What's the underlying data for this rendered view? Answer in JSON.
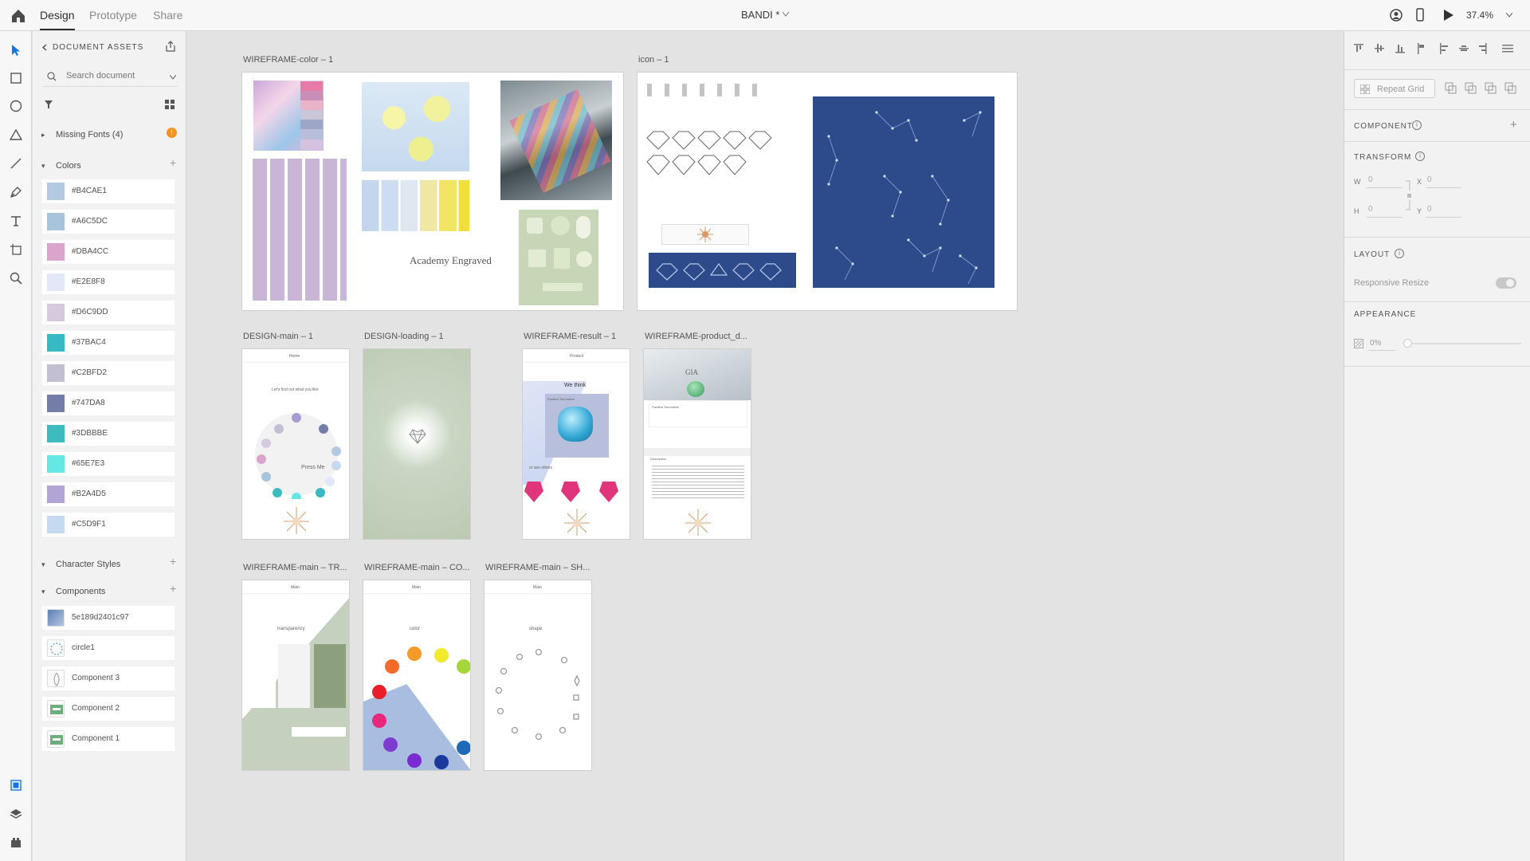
{
  "topbar": {
    "tabs": [
      "Design",
      "Prototype",
      "Share"
    ],
    "document_title": "BANDI *",
    "zoom": "37.4%"
  },
  "assets": {
    "header": "DOCUMENT ASSETS",
    "search_placeholder": "Search document",
    "missing_fonts": "Missing Fonts (4)",
    "colors_label": "Colors",
    "colors": [
      {
        "label": "#B4CAE1",
        "hex": "#B4CAE1"
      },
      {
        "label": "#A6C5DC",
        "hex": "#A6C5DC"
      },
      {
        "label": "#DBA4CC",
        "hex": "#DBA4CC"
      },
      {
        "label": "#E2E8F8",
        "hex": "#E2E8F8"
      },
      {
        "label": "#D6C9DD",
        "hex": "#D6C9DD"
      },
      {
        "label": "#37BAC4",
        "hex": "#37BAC4"
      },
      {
        "label": "#C2BFD2",
        "hex": "#C2BFD2"
      },
      {
        "label": "#747DA8",
        "hex": "#747DA8"
      },
      {
        "label": "#3DBBBE",
        "hex": "#3DBBBE"
      },
      {
        "label": "#65E7E3",
        "hex": "#65E7E3"
      },
      {
        "label": "#B2A4D5",
        "hex": "#B2A4D5"
      },
      {
        "label": "#C5D9F1",
        "hex": "#C5D9F1"
      }
    ],
    "character_styles_label": "Character Styles",
    "components_label": "Components",
    "components": [
      "5e189d2401c97",
      "circle1",
      "Component 3",
      "Component 2",
      "Component 1"
    ]
  },
  "canvas": {
    "artboards": [
      {
        "label": "WIREFRAME-color – 1"
      },
      {
        "label": "icon – 1"
      },
      {
        "label": "DESIGN-main – 1"
      },
      {
        "label": "DESIGN-loading – 1"
      },
      {
        "label": "WIREFRAME-result – 1"
      },
      {
        "label": "WIREFRAME-product_d..."
      },
      {
        "label": "WIREFRAME-main – TR..."
      },
      {
        "label": "WIREFRAME-main – CO..."
      },
      {
        "label": "WIREFRAME-main – SH..."
      }
    ],
    "texts": {
      "academy": "Academy Engraved",
      "home": "Home",
      "find_out": "Let's find out what you like",
      "press_me": "Press Me",
      "product": "Product",
      "we_think": "We think",
      "paraiba": "Paraiba Tourmaline",
      "or_see": "or see others",
      "description": "Description",
      "main": "Main",
      "transparency": "transparency",
      "color": "color",
      "shape": "shape",
      "gia": "GIA"
    }
  },
  "properties": {
    "repeat_grid": "Repeat Grid",
    "component": "COMPONENT",
    "transform": "TRANSFORM",
    "w_label": "W",
    "w_value": "0",
    "h_label": "H",
    "h_value": "0",
    "x_label": "X",
    "x_value": "0",
    "y_label": "Y",
    "y_value": "0",
    "layout": "LAYOUT",
    "responsive_resize": "Responsive Resize",
    "appearance": "APPEARANCE",
    "opacity": "0%"
  }
}
